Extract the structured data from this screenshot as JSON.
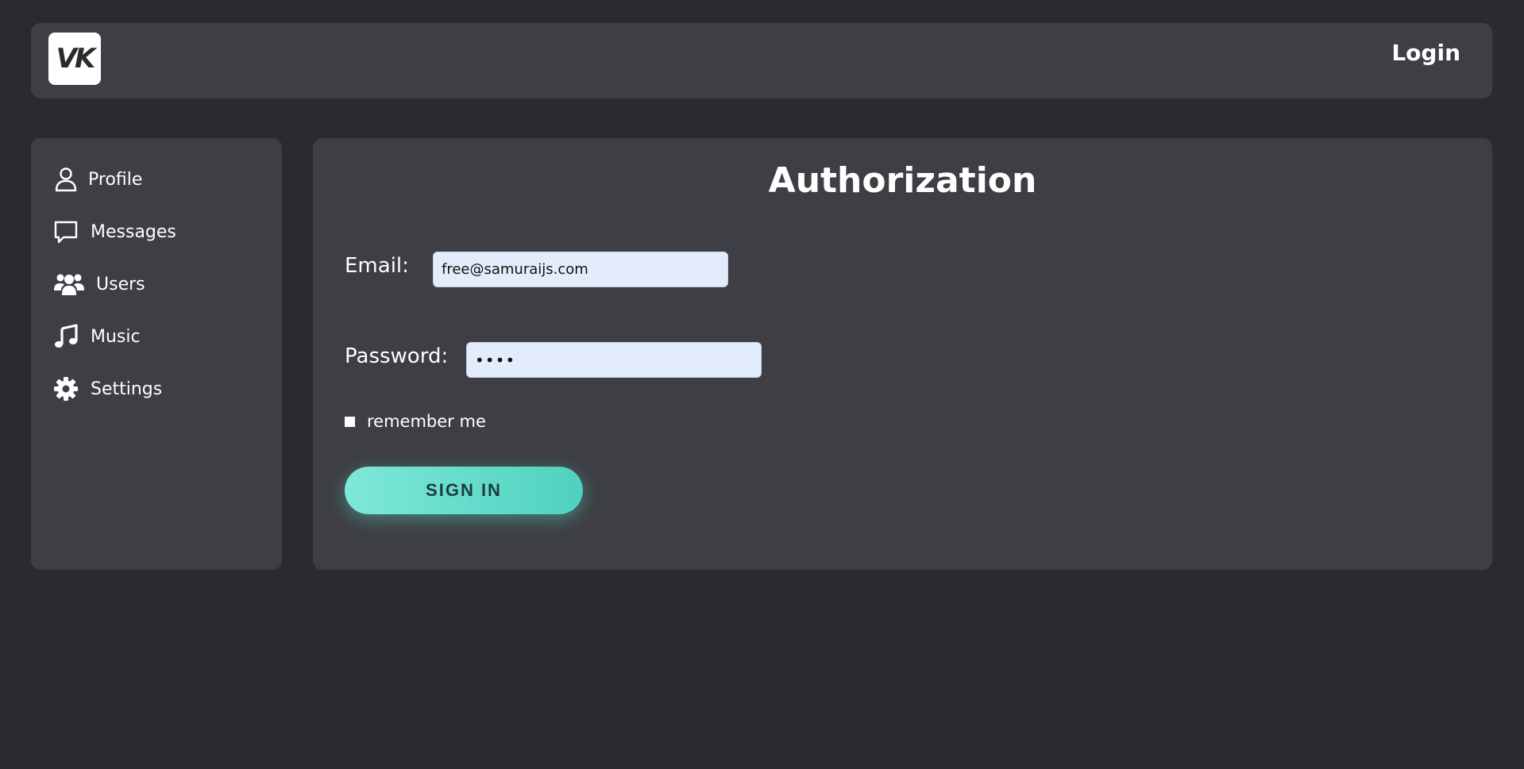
{
  "header": {
    "logo_icon": "vk-logo-icon",
    "logo_text": "VK",
    "login_label": "Login"
  },
  "sidebar": {
    "items": [
      {
        "label": "Profile",
        "icon": "user-icon"
      },
      {
        "label": "Messages",
        "icon": "message-icon"
      },
      {
        "label": "Users",
        "icon": "users-icon"
      },
      {
        "label": "Music",
        "icon": "music-icon"
      },
      {
        "label": "Settings",
        "icon": "gear-icon"
      }
    ]
  },
  "main": {
    "title": "Authorization",
    "email": {
      "label": "Email:",
      "value": "free@samuraijs.com"
    },
    "password": {
      "label": "Password:",
      "value": "••••"
    },
    "remember": {
      "label": "remember me",
      "checked": false
    },
    "signin_label": "SIGN IN"
  },
  "colors": {
    "background": "#2a2b2f",
    "panel": "#3e3f44",
    "input_bg": "#e3ecfb",
    "accent_start": "#7ee8d8",
    "accent_end": "#4fd1bf"
  }
}
